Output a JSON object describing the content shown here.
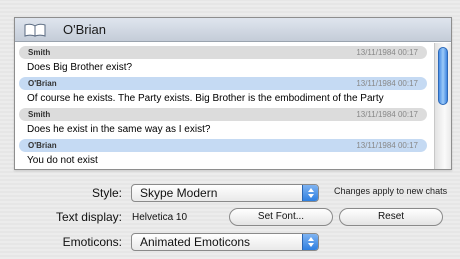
{
  "chat": {
    "title": "O'Brian",
    "messages": [
      {
        "sender": "Smith",
        "timestamp": "13/11/1984 00:17",
        "text": "Does Big Brother exist?"
      },
      {
        "sender": "O'Brian",
        "timestamp": "13/11/1984 00:17",
        "text": "Of course he exists. The Party exists. Big Brother is the embodiment of the Party"
      },
      {
        "sender": "Smith",
        "timestamp": "13/11/1984 00:17",
        "text": "Does he exist in the same way as I exist?"
      },
      {
        "sender": "O'Brian",
        "timestamp": "13/11/1984 00:17",
        "text": "You do not exist"
      }
    ]
  },
  "settings": {
    "style_label": "Style:",
    "style_value": "Skype Modern",
    "style_note": "Changes apply to new chats",
    "text_display_label": "Text display:",
    "text_display_value": "Helvetica 10",
    "set_font_button": "Set Font...",
    "reset_button": "Reset",
    "emoticons_label": "Emoticons:",
    "emoticons_value": "Animated Emoticons"
  },
  "colors": {
    "accent": "#3f86e0",
    "incoming_header": "#c5daf3",
    "outgoing_header": "#dcdcdc"
  },
  "icons": {
    "header_icon": "book-icon",
    "popup_icon": "updown-arrows-icon"
  }
}
